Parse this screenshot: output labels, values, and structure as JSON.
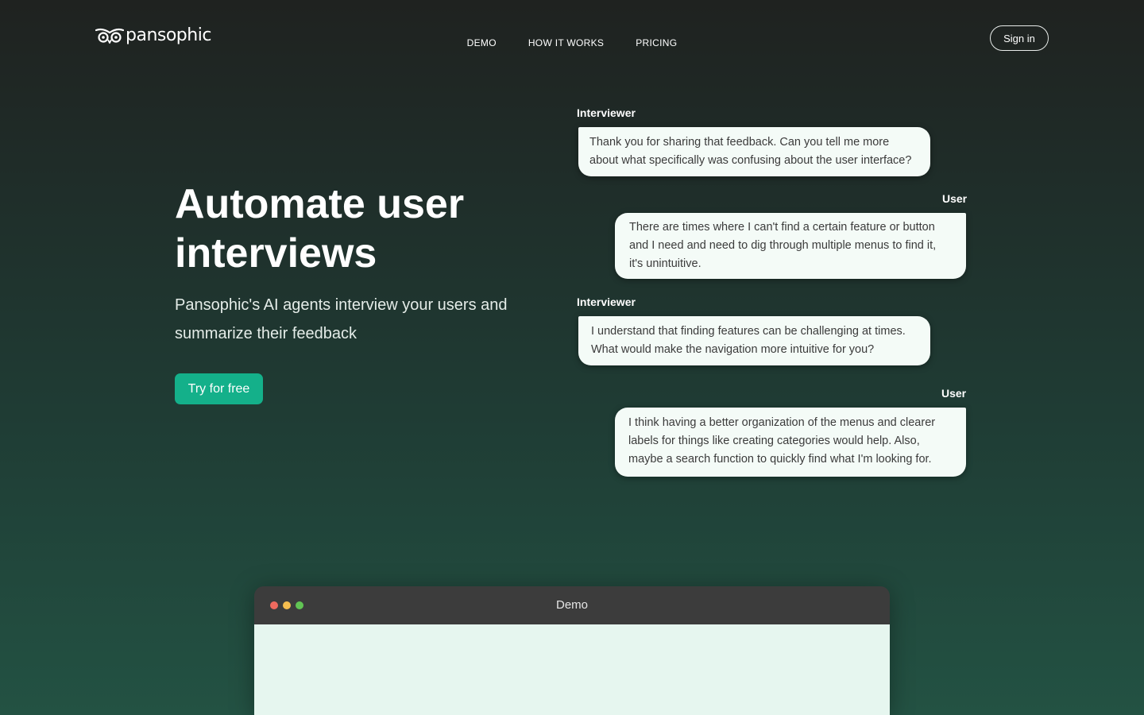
{
  "brand": {
    "name": "pansophic",
    "logo_icon": "owl-eyes-icon"
  },
  "nav": {
    "links": [
      "DEMO",
      "HOW IT WORKS",
      "PRICING"
    ],
    "sign_in_label": "Sign in"
  },
  "hero": {
    "title": "Automate user interviews",
    "subtitle": "Pansophic's AI agents interview your users and summarize their feedback",
    "cta_label": "Try for free"
  },
  "conversation": [
    {
      "speaker": "Interviewer",
      "text": "Thank you for sharing that feedback. Can you tell me more about what specifically was confusing about the user interface?"
    },
    {
      "speaker": "User",
      "text": "There are times where I can't find a certain feature or button and I need and need to dig through multiple menus to find it, it's unintuitive."
    },
    {
      "speaker": "Interviewer",
      "text": "I understand that finding features can be challenging at times. What would make the navigation more intuitive for you?"
    },
    {
      "speaker": "User",
      "text": "I think having a better organization of the menus and clearer labels for things like creating categories would help. Also, maybe a search function to quickly find what I'm looking for."
    }
  ],
  "demo_window": {
    "title": "Demo",
    "control_colors": [
      "#ee6a5f",
      "#f5bd4f",
      "#61c454"
    ]
  },
  "colors": {
    "accent": "#14b08a",
    "bubble_bg": "#f4fbf7",
    "demo_body": "#e6f6ef"
  }
}
